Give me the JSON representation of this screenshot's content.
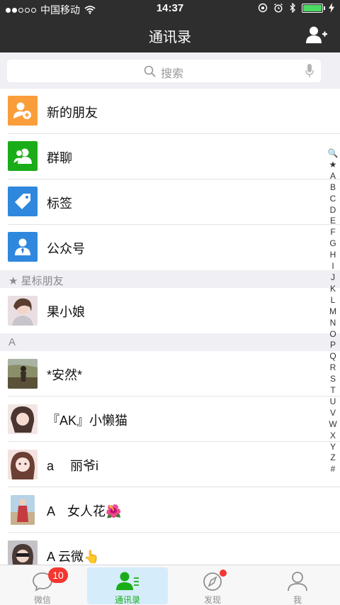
{
  "status": {
    "carrier": "中国移动",
    "time": "14:37"
  },
  "nav": {
    "title": "通讯录"
  },
  "search": {
    "placeholder": "搜索"
  },
  "system_items": [
    {
      "label": "新的朋友",
      "icon": "add-friend-icon",
      "color": "#fa9d3b"
    },
    {
      "label": "群聊",
      "icon": "group-chat-icon",
      "color": "#1aad19"
    },
    {
      "label": "标签",
      "icon": "tag-icon",
      "color": "#2f88dd"
    },
    {
      "label": "公众号",
      "icon": "official-account-icon",
      "color": "#2f88dd"
    }
  ],
  "sections": [
    {
      "title": "星标朋友",
      "icon": "star-icon"
    },
    {
      "title": "A"
    }
  ],
  "starred_contacts": [
    {
      "name": "果小娘"
    }
  ],
  "a_contacts": [
    {
      "name": "*安然*"
    },
    {
      "name": "『AK』小懒猫"
    },
    {
      "name": "a　 丽爷i"
    },
    {
      "name": "A　女人花🌺"
    },
    {
      "name": "A  云微👆"
    }
  ],
  "index_letters": [
    "🔍",
    "★",
    "A",
    "B",
    "C",
    "D",
    "E",
    "F",
    "G",
    "H",
    "I",
    "J",
    "K",
    "L",
    "M",
    "N",
    "O",
    "P",
    "Q",
    "R",
    "S",
    "T",
    "U",
    "V",
    "W",
    "X",
    "Y",
    "Z",
    "#"
  ],
  "tabs": [
    {
      "label": "微信",
      "badge": "10",
      "icon": "chat-icon"
    },
    {
      "label": "通讯录",
      "icon": "contacts-icon",
      "active": true
    },
    {
      "label": "发现",
      "icon": "discover-compass-icon"
    },
    {
      "label": "我",
      "icon": "me-profile-icon"
    }
  ],
  "colors": {
    "nav_bg": "#2e2e2f",
    "accent_green": "#1aad19",
    "badge_red": "#f43530",
    "section_bg": "#efeff4"
  }
}
